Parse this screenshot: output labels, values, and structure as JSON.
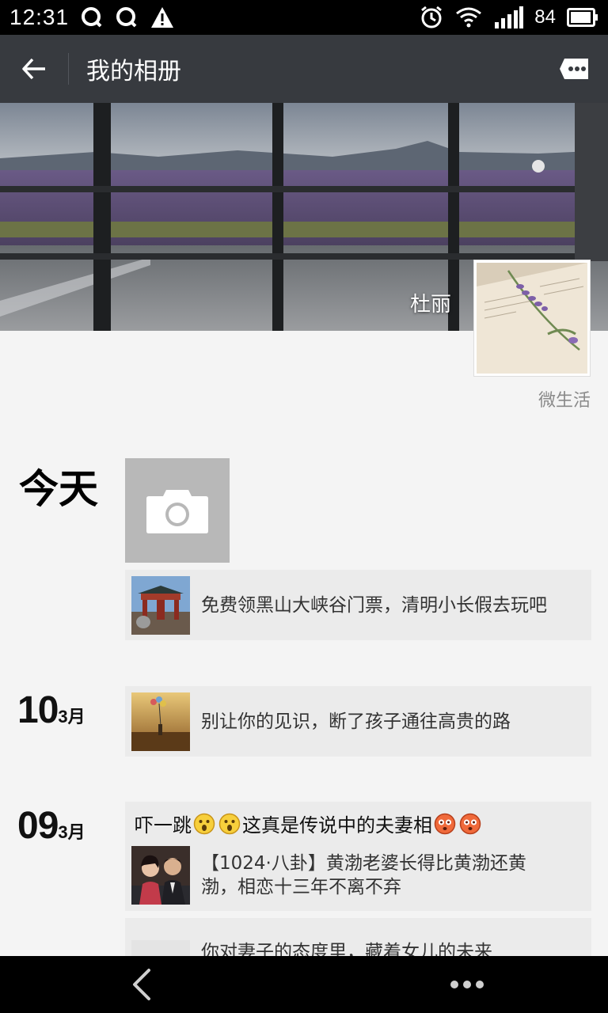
{
  "status_bar": {
    "time": "12:31",
    "battery": "84"
  },
  "app_bar": {
    "title": "我的相册"
  },
  "profile": {
    "name": "杜丽",
    "avatar_caption": "微生活"
  },
  "timeline": {
    "today_label": "今天",
    "entries": [
      {
        "text": "免费领黑山大峡谷门票，清明小长假去玩吧"
      },
      {
        "day": "10",
        "month": "3月",
        "text": "别让你的见识，断了孩子通往高贵的路"
      },
      {
        "day": "09",
        "month": "3月",
        "caption_a": "吓一跳",
        "caption_b": "这真是传说中的夫妻相",
        "text_line1": "【1024·八卦】黄渤老婆长得比黄渤还黄",
        "text_line2": "渤，相恋十三年不离不弃"
      },
      {
        "text": "你对妻子的态度里，藏着女儿的未来"
      }
    ]
  },
  "colors": {
    "app_bar_bg": "#373a3f",
    "card_bg": "#ebebeb",
    "page_bg": "#f4f4f4"
  }
}
